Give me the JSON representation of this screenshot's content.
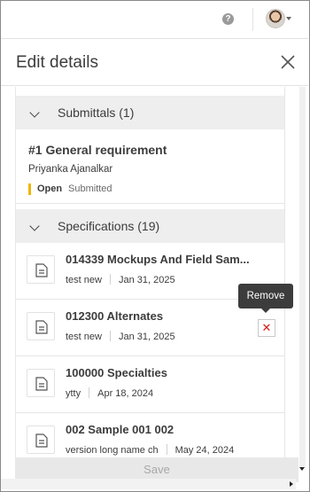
{
  "topbar": {
    "help_icon": "?"
  },
  "header": {
    "title": "Edit details",
    "close_icon": "close-icon"
  },
  "submittals": {
    "heading": "Submittals (1)",
    "item": {
      "title": "#1  General requirement",
      "person": "Priyanka Ajanalkar",
      "status": "Open",
      "state": "Submitted",
      "status_color": "#f0b500"
    }
  },
  "specifications": {
    "heading": "Specifications (19)",
    "items": [
      {
        "title": "014339 Mockups And Field Sam...",
        "meta1": "test new",
        "meta2": "Jan 31, 2025"
      },
      {
        "title": "012300 Alternates",
        "meta1": "test new",
        "meta2": "Jan 31, 2025"
      },
      {
        "title": "100000 Specialties",
        "meta1": "ytty",
        "meta2": "Apr 18, 2024"
      },
      {
        "title": "002 Sample 001 002",
        "meta1": "version long name ch",
        "meta2": "May 24, 2024"
      }
    ]
  },
  "tooltip": {
    "text": "Remove"
  },
  "remove_button": {
    "glyph": "✕"
  },
  "footer": {
    "save_label": "Save"
  }
}
